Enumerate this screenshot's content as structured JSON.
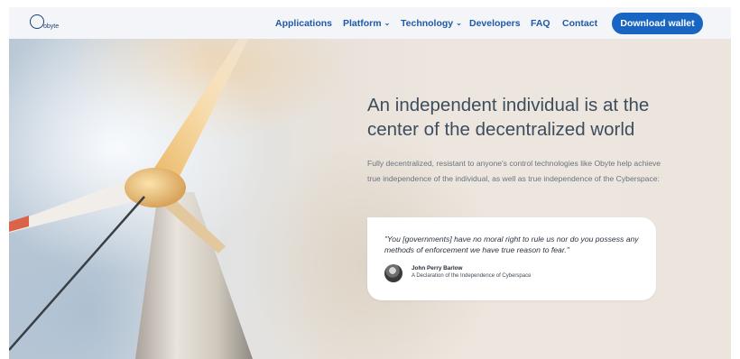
{
  "header": {
    "logo": {
      "brand": "obyte"
    },
    "nav": [
      {
        "label": "Applications",
        "dropdown": false
      },
      {
        "label": "Platform",
        "dropdown": true
      },
      {
        "label": "Technology",
        "dropdown": true
      },
      {
        "label": "Developers",
        "dropdown": false
      },
      {
        "label": "FAQ",
        "dropdown": false
      },
      {
        "label": "Contact",
        "dropdown": false
      }
    ],
    "download_button": "Download wallet"
  },
  "hero": {
    "title": "An independent individual is at the center of the decentralized world",
    "description": "Fully decentralized, resistant to anyone's control technologies like Obyte help achieve true independence of the individual, as well as true independence of the Cyberspace:",
    "quote": {
      "text": "\"You [governments] have no moral right to rule us nor do you possess any methods of enforcement we have true reason to fear.\"",
      "author": "John Perry Barlow",
      "source": "A Declaration of the Independence of Cyberspace"
    }
  },
  "colors": {
    "accent": "#1866c2",
    "nav_text": "#1e5aa8",
    "title_text": "#3d4d5e"
  }
}
